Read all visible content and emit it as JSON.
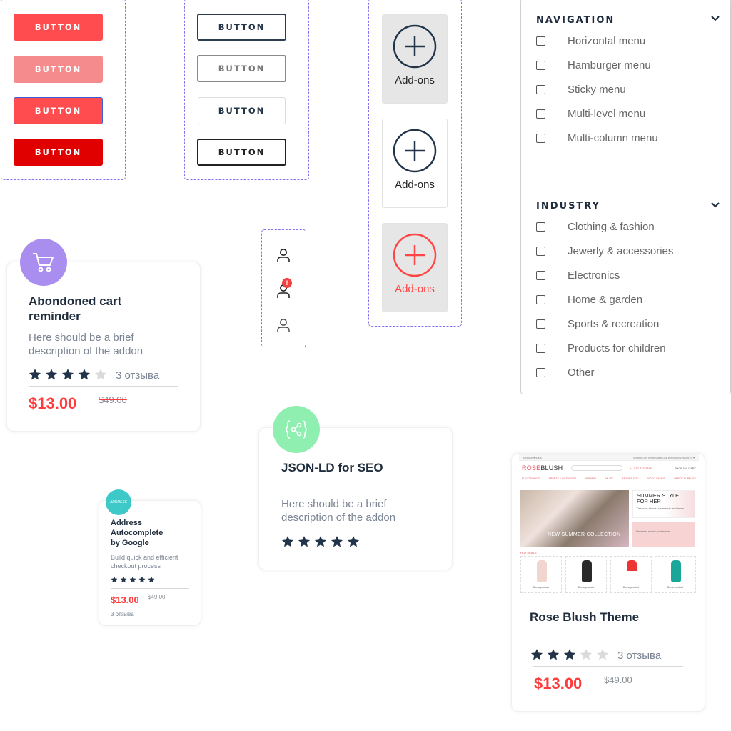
{
  "buttons_filled": {
    "items": [
      {
        "label": "BUTTON",
        "state": "default"
      },
      {
        "label": "BUTTON",
        "state": "disabled"
      },
      {
        "label": "BUTTON",
        "state": "focused"
      },
      {
        "label": "BUTTON",
        "state": "pressed"
      }
    ],
    "colors": {
      "default": "#ff4d4f",
      "disabled": "#f58b8d",
      "pressed": "#e10000",
      "focus_ring": "#3d5bd6"
    }
  },
  "buttons_outline": {
    "items": [
      {
        "label": "BUTTON",
        "state": "default"
      },
      {
        "label": "BUTTON",
        "state": "disabled"
      },
      {
        "label": "BUTTON",
        "state": "hover"
      },
      {
        "label": "BUTTON",
        "state": "pressed"
      }
    ]
  },
  "addon_tiles": [
    {
      "label": "Add-ons",
      "icon": "plus-circle-icon",
      "state": "hover"
    },
    {
      "label": "Add-ons",
      "icon": "plus-circle-icon",
      "state": "default"
    },
    {
      "label": "Add-ons",
      "icon": "plus-circle-icon",
      "state": "active"
    }
  ],
  "user_icons": [
    {
      "icon": "user-icon",
      "badge": null
    },
    {
      "icon": "user-icon",
      "badge": "!"
    },
    {
      "icon": "user-icon",
      "badge": null
    }
  ],
  "filters": {
    "sections": [
      {
        "title": "NAVIGATION",
        "items": [
          "Horizontal menu",
          "Hamburger menu",
          "Sticky menu",
          "Multi-level menu",
          "Multi-column menu"
        ]
      },
      {
        "title": "INDUSTRY",
        "items": [
          "Clothing & fashion",
          "Jewerly & accessories",
          "Electronics",
          "Home & garden",
          "Sports & recreation",
          "Products for children",
          "Other"
        ]
      }
    ]
  },
  "cards": {
    "cart": {
      "title_line1": "Abondoned cart",
      "title_line2": "reminder",
      "desc_line1": "Here should be a brief",
      "desc_line2": "description of the addon",
      "rating": 4,
      "max_rating": 5,
      "reviews": "3 отзыва",
      "price": "$13.00",
      "old_price": "$49.00",
      "icon": "shopping-cart-icon",
      "icon_color": "#a98ef0"
    },
    "address": {
      "title_line1": "Address",
      "title_line2": "Autocomplete",
      "title_line3": "by Google",
      "desc_line1": "Build quick and efficient",
      "desc_line2": "checkout process",
      "rating": 5,
      "max_rating": 5,
      "price": "$13.00",
      "old_price": "$49.00",
      "reviews": "3 отзыва",
      "icon_text": "ADDRESS",
      "icon_color": "#3ec9c9"
    },
    "json": {
      "title": "JSON-LD for SEO",
      "desc_line1": "Here should be a brief",
      "desc_line2": "description of the addon",
      "rating": 5,
      "max_rating": 5,
      "icon": "code-share-icon",
      "icon_color": "#8fefb0"
    },
    "theme": {
      "title": "Rose Blush Theme",
      "rating": 3,
      "max_rating": 5,
      "reviews": "3 отзыва",
      "price": "$13.00",
      "old_price": "$49.00",
      "preview": {
        "logo_a": "ROSE",
        "logo_b": "BLUSH",
        "top_left": "English ▾  $  €  £",
        "top_right": "Sorting   Gift certificates   Our brands   My Account ▾",
        "phone": "+1 917-733-7468",
        "cart": "SHOP MY CART",
        "nav": [
          "ELECTRONICS",
          "SPORTS & OUTDOORS",
          "APPAREL",
          "MUSIC",
          "MOVIES & TV",
          "VIDEO GAMES",
          "OFFICE SUPPLIES"
        ],
        "hero_text": "NEW SUMMER COLLECTION",
        "side_title_1": "SUMMER STYLE",
        "side_title_2": "FOR HER",
        "side_sub": "Dresses, shorts, swimwear and more",
        "side2_sub": "Dresses, shorts, swimwear",
        "hot_label": "HOT DEALS",
        "products": [
          "Demo product",
          "Demo product",
          "Demo product",
          "Demo product"
        ]
      }
    }
  },
  "colors": {
    "accent_red": "#ff3b3b",
    "navy": "#1f2d3d",
    "dash": "#8a6cf0"
  }
}
